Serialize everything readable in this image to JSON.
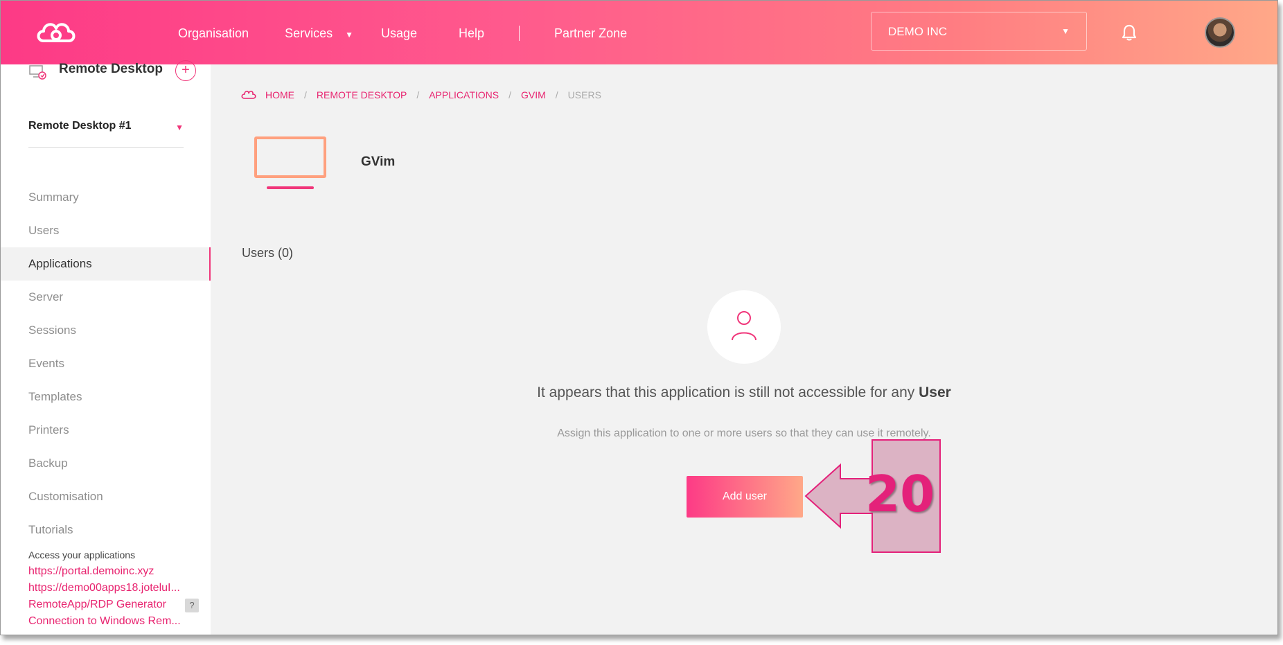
{
  "topbar": {
    "nav": [
      {
        "label": "Organisation"
      },
      {
        "label": "Services"
      },
      {
        "label": "Usage"
      },
      {
        "label": "Help"
      }
    ],
    "partner_zone": "Partner Zone",
    "organization": "DEMO INC"
  },
  "sidebar": {
    "title": "Remote Desktop",
    "add_symbol": "+",
    "selected_desktop": "Remote Desktop #1",
    "menu": [
      {
        "label": "Summary"
      },
      {
        "label": "Users"
      },
      {
        "label": "Applications",
        "active": true
      },
      {
        "label": "Server"
      },
      {
        "label": "Sessions"
      },
      {
        "label": "Events"
      },
      {
        "label": "Templates"
      },
      {
        "label": "Printers"
      },
      {
        "label": "Backup"
      },
      {
        "label": "Customisation"
      },
      {
        "label": "Tutorials"
      }
    ],
    "access_label": "Access your applications",
    "access_links": [
      "https://portal.demoinc.xyz",
      "https://demo00apps18.joteluI...",
      "RemoteApp/RDP Generator",
      "Connection to Windows Rem..."
    ],
    "help_symbol": "?"
  },
  "breadcrumb": [
    "HOME",
    "REMOTE DESKTOP",
    "APPLICATIONS",
    "GVIM",
    "USERS"
  ],
  "app": {
    "name": "GVim"
  },
  "users_count": "Users (0)",
  "empty_state": {
    "title_prefix": "It appears that this application is still not accessible for any",
    "title_bold": "User",
    "subtitle": "Assign this application to one or more users so that they can use it remotely.",
    "button": "Add user"
  },
  "callout": {
    "number": "20"
  },
  "colors": {
    "accent": "#f0367a",
    "gradient_start": "#fd3a86",
    "gradient_end": "#ffa888",
    "app_icon": "#ffa07e"
  }
}
